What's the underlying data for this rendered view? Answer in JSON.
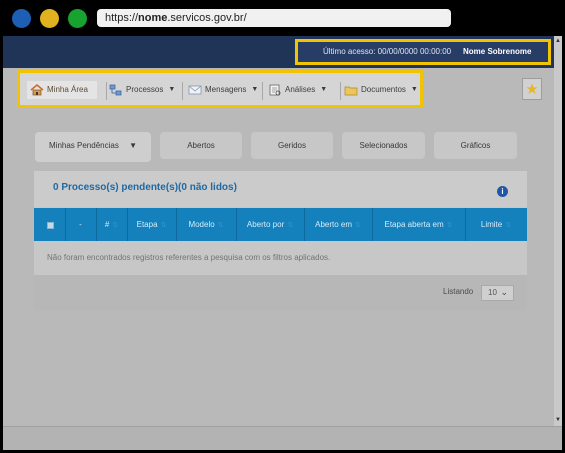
{
  "browser": {
    "url_prefix": "https://",
    "url_host": "nome",
    "url_rest": ".servicos.gov.br/"
  },
  "header": {
    "last_access": "Último acesso: 00/00/0000 00:00:00",
    "user_name": "Nome Sobrenome"
  },
  "menu": {
    "items": [
      {
        "label": "Minha Área",
        "icon": "home-icon"
      },
      {
        "label": "Processos",
        "icon": "processes-icon"
      },
      {
        "label": "Mensagens",
        "icon": "mail-icon"
      },
      {
        "label": "Análises",
        "icon": "analysis-icon"
      },
      {
        "label": "Documentos",
        "icon": "folder-icon"
      }
    ]
  },
  "tabs": [
    {
      "label": "Minhas Pendências"
    },
    {
      "label": "Abertos"
    },
    {
      "label": "Geridos"
    },
    {
      "label": "Selecionados"
    },
    {
      "label": "Gráficos"
    }
  ],
  "panel": {
    "title": "0 Processo(s) pendente(s)(0 não lidos)"
  },
  "table": {
    "columns": [
      "-",
      "#",
      "Etapa",
      "Modelo",
      "Aberto por",
      "Aberto em",
      "Etapa aberta em",
      "Limite"
    ],
    "empty_message": "Não foram encontrados registros referentes a pesquisa com os filtros aplicados."
  },
  "footer": {
    "listing_label": "Listando",
    "page_size": "10"
  },
  "colors": {
    "highlight": "#f2c300",
    "header_blue": "#1481bd",
    "title_blue": "#1f69a3"
  }
}
